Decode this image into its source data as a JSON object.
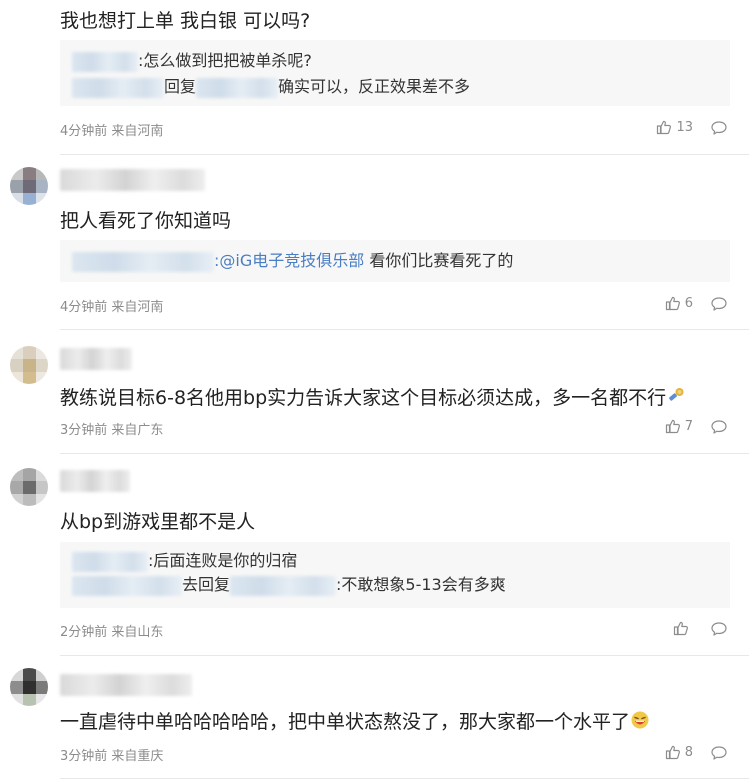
{
  "comments": [
    {
      "content": "我也想打上单 我白银 可以吗?",
      "replies": [
        {
          "text": ":怎么做到把把被单杀呢?"
        },
        {
          "prefix": "回复",
          "text": "确实可以，反正效果差不多"
        }
      ],
      "meta": "4分钟前 来自河南",
      "likes": "13"
    },
    {
      "content": "把人看死了你知道吗",
      "replies": [
        {
          "mention": ":@iG电子竞技俱乐部",
          "text": " 看你们比赛看死了的"
        }
      ],
      "meta": "4分钟前 来自河南",
      "likes": "6"
    },
    {
      "content": "教练说目标6-8名他用bp实力告诉大家这个目标必须达成，多一名都不行",
      "meta": "3分钟前 来自广东",
      "likes": "7"
    },
    {
      "content": "从bp到游戏里都不是人",
      "replies": [
        {
          "text": ":后面连败是你的归宿"
        },
        {
          "prefix": "去回复",
          "text": ":不敢想象5-13会有多爽"
        }
      ],
      "meta": "2分钟前 来自山东",
      "likes": ""
    },
    {
      "content": "一直虐待中单哈哈哈哈哈，把中单状态熬没了，那大家都一个水平了",
      "meta": "3分钟前 来自重庆",
      "likes": "8"
    }
  ],
  "icons": {
    "like": "thumbs-up-icon",
    "reply": "comment-bubble-icon",
    "emoji_3": "microphone-emoji",
    "emoji_5": "laughing-face-emoji"
  },
  "colors": {
    "mention": "#4a7ec3",
    "meta": "#8c8c8c",
    "reply_bg": "#f7f7f7"
  }
}
